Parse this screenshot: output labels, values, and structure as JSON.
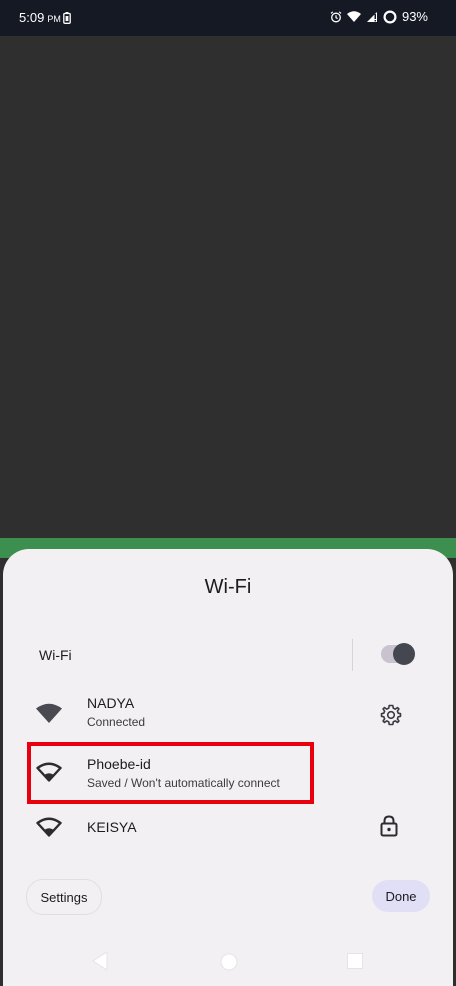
{
  "status_bar": {
    "time": "5:09",
    "ampm": "PM",
    "battery_percent": "93%",
    "icons": [
      "battery-saver-icon",
      "alarm-icon",
      "wifi-icon",
      "cell-signal-icon",
      "battery-ring-icon"
    ]
  },
  "sheet": {
    "title": "Wi-Fi",
    "toggle_label": "Wi-Fi",
    "toggle_on": true,
    "networks": [
      {
        "name": "NADYA",
        "status": "Connected",
        "icon": "wifi-full-icon",
        "action_icon": "gear-icon"
      },
      {
        "name": "Phoebe-id",
        "status": "Saved / Won't automatically connect",
        "icon": "wifi-outline-icon",
        "action_icon": ""
      },
      {
        "name": "KEISYA",
        "status": "",
        "icon": "wifi-outline-icon",
        "action_icon": "lock-icon"
      }
    ],
    "settings_label": "Settings",
    "done_label": "Done"
  },
  "colors": {
    "highlight": "#e8000f",
    "sheet_bg": "#f3f0f3",
    "done_bg": "#e0dff5",
    "status_bar_bg": "#141923"
  }
}
